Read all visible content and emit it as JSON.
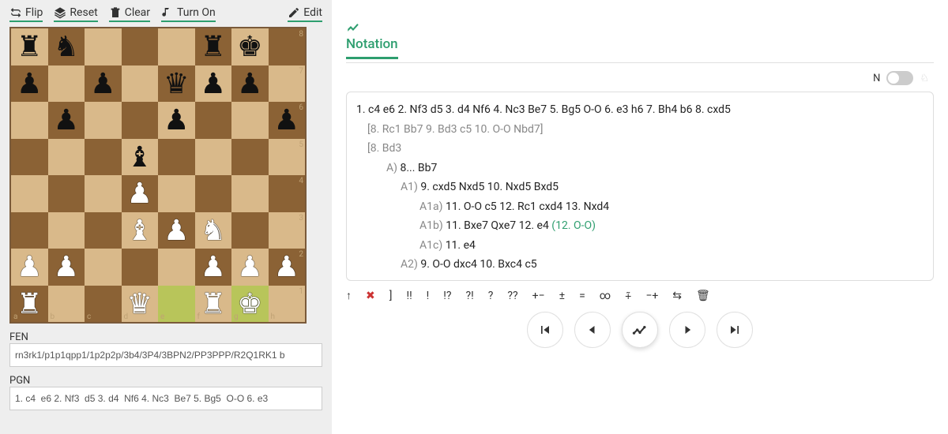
{
  "toolbar": {
    "flip": "Flip",
    "reset": "Reset",
    "clear": "Clear",
    "turn_on": "Turn On",
    "edit": "Edit"
  },
  "board": {
    "ranks": [
      "8",
      "7",
      "6",
      "5",
      "4",
      "3",
      "2",
      "1"
    ],
    "files": [
      "a",
      "b",
      "c",
      "d",
      "e",
      "f",
      "g",
      "h"
    ],
    "pieces": {
      "a8": "br",
      "b8": "bn",
      "f8": "br",
      "g8": "bk",
      "a7": "bp",
      "c7": "bp",
      "e7": "bq",
      "f7": "bp",
      "g7": "bp",
      "b6": "bp",
      "e6": "bp",
      "h6": "bp",
      "d5": "bb",
      "d4": "wp",
      "d3": "wb",
      "e3": "wp",
      "f3": "wn",
      "a2": "wp",
      "b2": "wp",
      "f2": "wp",
      "g2": "wp",
      "h2": "wp",
      "a1": "wr",
      "d1": "wq",
      "f1": "wr",
      "g1": "wk"
    },
    "highlight": [
      "e1",
      "g1"
    ]
  },
  "fen": {
    "label": "FEN",
    "value": "rn3rk1/p1p1qpp1/1p2p2p/3b4/3P4/3BPN2/PP3PPP/R2Q1RK1 b"
  },
  "pgn": {
    "label": "PGN",
    "value": "1. c4  e6 2. Nf3  d5 3. d4  Nf6 4. Nc3  Be7 5. Bg5  O-O 6. e3"
  },
  "notation_tab": "Notation",
  "toggle": {
    "left": "N",
    "right": "♘"
  },
  "mainline": "1. c4  e6  2. Nf3  d5  3. d4  Nf6  4. Nc3  Be7  5. Bg5  O-O  6. e3  h6  7. Bh4  b6  8. cxd5",
  "variation1": "[8. Rc1  Bb7  9. Bd3  c5  10. O-O  Nbd7]",
  "variation2_open": "[8. Bd3",
  "branch_A": "A) ",
  "branch_A_moves": "8... Bb7",
  "branch_A1": "A1) ",
  "branch_A1_moves": "9. cxd5  Nxd5  10. Nxd5  Bxd5",
  "branch_A1a": "A1a) ",
  "branch_A1a_moves": "11. O-O  c5  12. Rc1  cxd4  13. Nxd4",
  "branch_A1b": "A1b) ",
  "branch_A1b_moves": "11. Bxe7  Qxe7  12. e4 ",
  "branch_A1b_green": "(12. O-O)",
  "branch_A1c": "A1c) ",
  "branch_A1c_moves": "11. e4",
  "branch_A2": "A2) ",
  "branch_A2_moves": "9. O-O  dxc4  10. Bxc4  c5",
  "symbols": [
    "↑",
    "✖",
    "]",
    "!!",
    "!",
    "!?",
    "?!",
    "?",
    "??",
    "+−",
    "±",
    "=",
    "∞",
    "⨤",
    "−+",
    "⇆",
    "🗑"
  ],
  "nav": [
    "first",
    "prev",
    "wave",
    "next",
    "last"
  ]
}
